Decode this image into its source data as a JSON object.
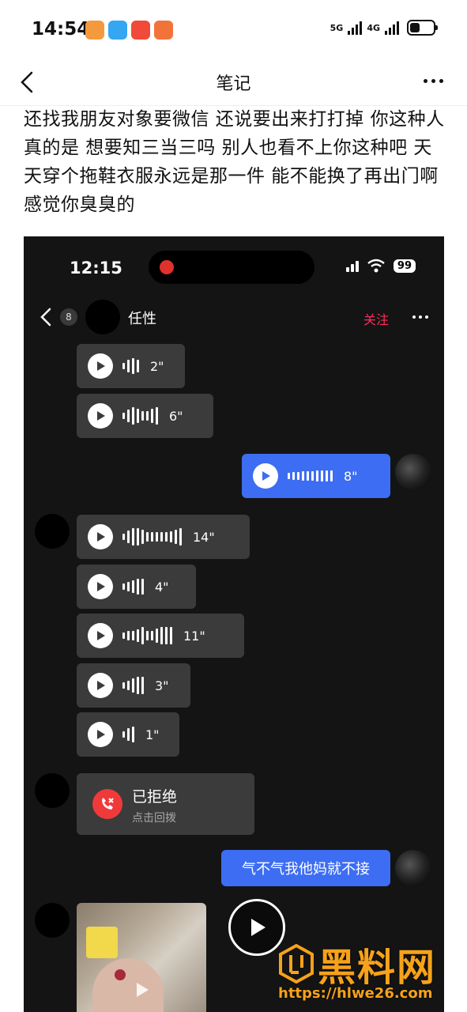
{
  "status_bar": {
    "time": "14:54",
    "network": [
      "5G",
      "4G"
    ],
    "app_icons": [
      {
        "name": "cloud-app-icon",
        "color": "#f59a3c"
      },
      {
        "name": "5g-app-icon",
        "color": "#34a6f2"
      },
      {
        "name": "mini-program-icon",
        "color": "#f04a3a"
      },
      {
        "name": "grid-app-icon",
        "color": "#f2733a"
      }
    ]
  },
  "header": {
    "title": "笔记"
  },
  "note": {
    "text": "还找我朋友对象要微信 还说要出来打打掉 你这种人真的是 想要知三当三吗 别人也看不上你这种吧 天天穿个拖鞋衣服永远是那一件 能不能换了再出门啊感觉你臭臭的"
  },
  "screenshot": {
    "time": "12:15",
    "battery": "99",
    "unread_count": "8",
    "contact_name": "任性",
    "follow_label": "关注",
    "voice_messages": [
      {
        "duration": "2\"",
        "sender": "other",
        "bars": [
          8,
          16,
          20,
          16
        ]
      },
      {
        "duration": "6\"",
        "sender": "other",
        "bars": [
          8,
          16,
          22,
          18,
          12,
          12,
          18,
          22
        ]
      },
      {
        "duration": "8\"",
        "sender": "me",
        "bars": [
          8,
          10,
          10,
          12,
          12,
          12,
          14,
          14,
          14,
          14
        ]
      },
      {
        "duration": "14\"",
        "sender": "other",
        "bars": [
          8,
          16,
          22,
          22,
          18,
          12,
          12,
          12,
          12,
          12,
          14,
          18,
          22
        ]
      },
      {
        "duration": "4\"",
        "sender": "other",
        "bars": [
          8,
          12,
          16,
          20,
          20
        ]
      },
      {
        "duration": "11\"",
        "sender": "other",
        "bars": [
          8,
          12,
          12,
          16,
          22,
          12,
          12,
          18,
          22,
          22,
          22
        ]
      },
      {
        "duration": "3\"",
        "sender": "other",
        "bars": [
          8,
          12,
          18,
          22,
          22
        ]
      },
      {
        "duration": "1\"",
        "sender": "other",
        "bars": [
          8,
          16,
          20
        ]
      }
    ],
    "call": {
      "title": "已拒绝",
      "subtitle": "点击回拨"
    },
    "my_text_message": "气不气我他妈就不接"
  },
  "watermark": {
    "name": "黑料网",
    "url": "https://hlwe26.com"
  }
}
